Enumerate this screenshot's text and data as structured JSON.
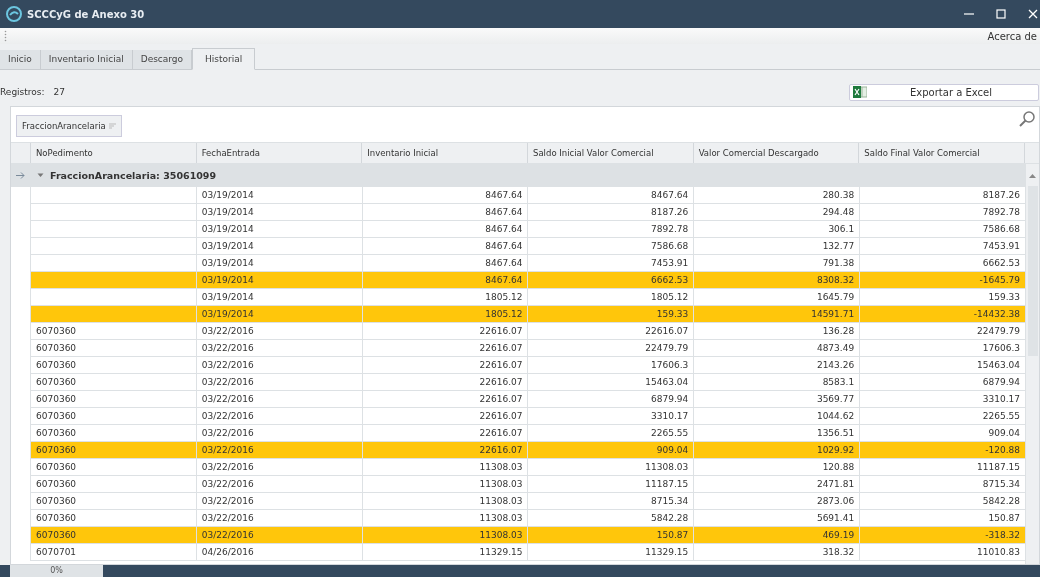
{
  "window": {
    "title": "SCCCyG de Anexo 30"
  },
  "menu": {
    "items": [
      "Acerca de"
    ]
  },
  "tabs": [
    {
      "label": "Inicio",
      "selected": false
    },
    {
      "label": "Inventario Inicial",
      "selected": false
    },
    {
      "label": "Descargo",
      "selected": false
    },
    {
      "label": "Historial",
      "selected": true
    }
  ],
  "records": {
    "label": "Registros:",
    "count": "27"
  },
  "export_button": {
    "label": "Exportar a Excel"
  },
  "group_panel": {
    "chips": [
      "FraccionArancelaria"
    ]
  },
  "table": {
    "columns": [
      "NoPedimento",
      "FechaEntrada",
      "Inventario Inicial",
      "Saldo Inicial Valor Comercial",
      "Valor Comercial Descargado",
      "Saldo Final Valor Comercial"
    ],
    "group": {
      "label": "FraccionArancelaria: 35061099",
      "expanded": true
    },
    "rows": [
      {
        "highlighted": false,
        "cells": [
          "",
          "03/19/2014",
          "8467.64",
          "8467.64",
          "280.38",
          "8187.26"
        ]
      },
      {
        "highlighted": false,
        "cells": [
          "",
          "03/19/2014",
          "8467.64",
          "8187.26",
          "294.48",
          "7892.78"
        ]
      },
      {
        "highlighted": false,
        "cells": [
          "",
          "03/19/2014",
          "8467.64",
          "7892.78",
          "306.1",
          "7586.68"
        ]
      },
      {
        "highlighted": false,
        "cells": [
          "",
          "03/19/2014",
          "8467.64",
          "7586.68",
          "132.77",
          "7453.91"
        ]
      },
      {
        "highlighted": false,
        "cells": [
          "",
          "03/19/2014",
          "8467.64",
          "7453.91",
          "791.38",
          "6662.53"
        ]
      },
      {
        "highlighted": true,
        "cells": [
          "",
          "03/19/2014",
          "8467.64",
          "6662.53",
          "8308.32",
          "-1645.79"
        ]
      },
      {
        "highlighted": false,
        "cells": [
          "",
          "03/19/2014",
          "1805.12",
          "1805.12",
          "1645.79",
          "159.33"
        ]
      },
      {
        "highlighted": true,
        "cells": [
          "",
          "03/19/2014",
          "1805.12",
          "159.33",
          "14591.71",
          "-14432.38"
        ]
      },
      {
        "highlighted": false,
        "cells": [
          "6070360",
          "03/22/2016",
          "22616.07",
          "22616.07",
          "136.28",
          "22479.79"
        ]
      },
      {
        "highlighted": false,
        "cells": [
          "6070360",
          "03/22/2016",
          "22616.07",
          "22479.79",
          "4873.49",
          "17606.3"
        ]
      },
      {
        "highlighted": false,
        "cells": [
          "6070360",
          "03/22/2016",
          "22616.07",
          "17606.3",
          "2143.26",
          "15463.04"
        ]
      },
      {
        "highlighted": false,
        "cells": [
          "6070360",
          "03/22/2016",
          "22616.07",
          "15463.04",
          "8583.1",
          "6879.94"
        ]
      },
      {
        "highlighted": false,
        "cells": [
          "6070360",
          "03/22/2016",
          "22616.07",
          "6879.94",
          "3569.77",
          "3310.17"
        ]
      },
      {
        "highlighted": false,
        "cells": [
          "6070360",
          "03/22/2016",
          "22616.07",
          "3310.17",
          "1044.62",
          "2265.55"
        ]
      },
      {
        "highlighted": false,
        "cells": [
          "6070360",
          "03/22/2016",
          "22616.07",
          "2265.55",
          "1356.51",
          "909.04"
        ]
      },
      {
        "highlighted": true,
        "cells": [
          "6070360",
          "03/22/2016",
          "22616.07",
          "909.04",
          "1029.92",
          "-120.88"
        ]
      },
      {
        "highlighted": false,
        "cells": [
          "6070360",
          "03/22/2016",
          "11308.03",
          "11308.03",
          "120.88",
          "11187.15"
        ]
      },
      {
        "highlighted": false,
        "cells": [
          "6070360",
          "03/22/2016",
          "11308.03",
          "11187.15",
          "2471.81",
          "8715.34"
        ]
      },
      {
        "highlighted": false,
        "cells": [
          "6070360",
          "03/22/2016",
          "11308.03",
          "8715.34",
          "2873.06",
          "5842.28"
        ]
      },
      {
        "highlighted": false,
        "cells": [
          "6070360",
          "03/22/2016",
          "11308.03",
          "5842.28",
          "5691.41",
          "150.87"
        ]
      },
      {
        "highlighted": true,
        "cells": [
          "6070360",
          "03/22/2016",
          "11308.03",
          "150.87",
          "469.19",
          "-318.32"
        ]
      },
      {
        "highlighted": false,
        "cells": [
          "6070701",
          "04/26/2016",
          "11329.15",
          "11329.15",
          "318.32",
          "11010.83"
        ]
      }
    ]
  },
  "status_bar": {
    "progress_label": "0%"
  }
}
